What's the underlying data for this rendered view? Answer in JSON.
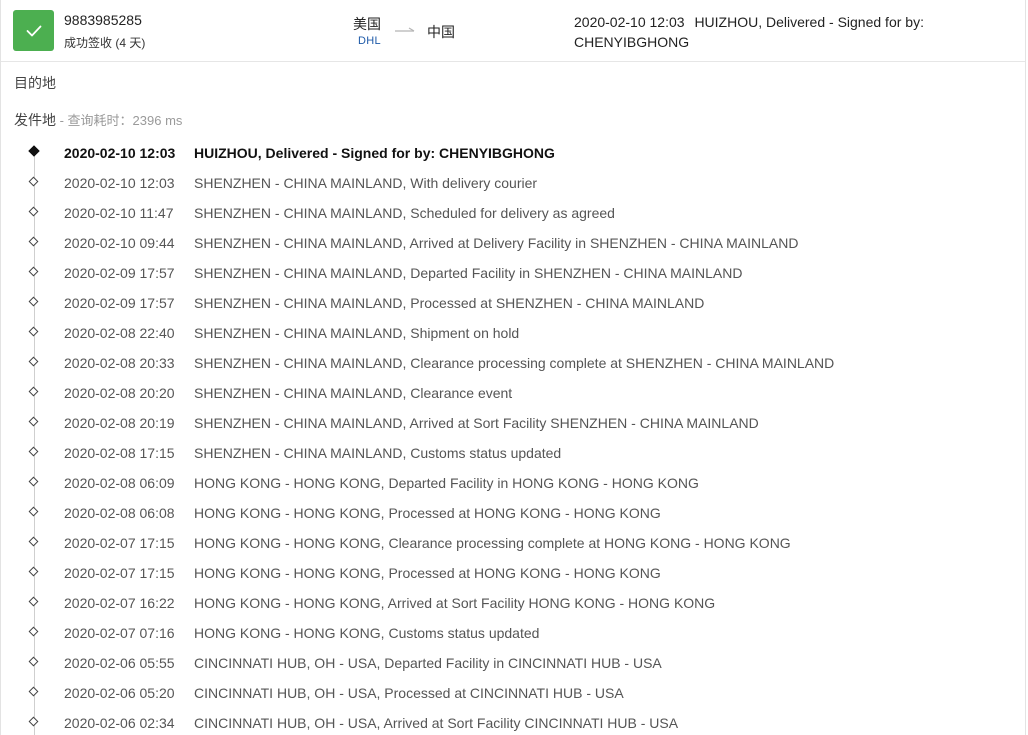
{
  "shipment": {
    "tracking_number": "9883985285",
    "status_text": "成功签收 (4 天)",
    "origin_country": "美国",
    "carrier": "DHL",
    "destination_country": "中国",
    "latest_time": "2020-02-10 12:03",
    "latest_desc": "HUIZHOU, Delivered - Signed for by: CHENYIBGHONG",
    "status_color": "#4caf50"
  },
  "sections": {
    "destination_label": "目的地",
    "origin_label": "发件地",
    "query_time": " - 查询耗时：2396 ms"
  },
  "events": [
    {
      "time": "2020-02-10 12:03",
      "desc": "HUIZHOU, Delivered - Signed for by: CHENYIBGHONG"
    },
    {
      "time": "2020-02-10 12:03",
      "desc": "SHENZHEN - CHINA MAINLAND, With delivery courier"
    },
    {
      "time": "2020-02-10 11:47",
      "desc": "SHENZHEN - CHINA MAINLAND, Scheduled for delivery as agreed"
    },
    {
      "time": "2020-02-10 09:44",
      "desc": "SHENZHEN - CHINA MAINLAND, Arrived at Delivery Facility in SHENZHEN - CHINA MAINLAND"
    },
    {
      "time": "2020-02-09 17:57",
      "desc": "SHENZHEN - CHINA MAINLAND, Departed Facility in SHENZHEN - CHINA MAINLAND"
    },
    {
      "time": "2020-02-09 17:57",
      "desc": "SHENZHEN - CHINA MAINLAND, Processed at SHENZHEN - CHINA MAINLAND"
    },
    {
      "time": "2020-02-08 22:40",
      "desc": "SHENZHEN - CHINA MAINLAND, Shipment on hold"
    },
    {
      "time": "2020-02-08 20:33",
      "desc": "SHENZHEN - CHINA MAINLAND, Clearance processing complete at SHENZHEN - CHINA MAINLAND"
    },
    {
      "time": "2020-02-08 20:20",
      "desc": "SHENZHEN - CHINA MAINLAND, Clearance event"
    },
    {
      "time": "2020-02-08 20:19",
      "desc": "SHENZHEN - CHINA MAINLAND, Arrived at Sort Facility SHENZHEN - CHINA MAINLAND"
    },
    {
      "time": "2020-02-08 17:15",
      "desc": "SHENZHEN - CHINA MAINLAND, Customs status updated"
    },
    {
      "time": "2020-02-08 06:09",
      "desc": "HONG KONG - HONG KONG, Departed Facility in HONG KONG - HONG KONG"
    },
    {
      "time": "2020-02-08 06:08",
      "desc": "HONG KONG - HONG KONG, Processed at HONG KONG - HONG KONG"
    },
    {
      "time": "2020-02-07 17:15",
      "desc": "HONG KONG - HONG KONG, Clearance processing complete at HONG KONG - HONG KONG"
    },
    {
      "time": "2020-02-07 17:15",
      "desc": "HONG KONG - HONG KONG, Processed at HONG KONG - HONG KONG"
    },
    {
      "time": "2020-02-07 16:22",
      "desc": "HONG KONG - HONG KONG, Arrived at Sort Facility HONG KONG - HONG KONG"
    },
    {
      "time": "2020-02-07 07:16",
      "desc": "HONG KONG - HONG KONG, Customs status updated"
    },
    {
      "time": "2020-02-06 05:55",
      "desc": "CINCINNATI HUB, OH - USA, Departed Facility in CINCINNATI HUB - USA"
    },
    {
      "time": "2020-02-06 05:20",
      "desc": "CINCINNATI HUB, OH - USA, Processed at CINCINNATI HUB - USA"
    },
    {
      "time": "2020-02-06 02:34",
      "desc": "CINCINNATI HUB, OH - USA, Arrived at Sort Facility CINCINNATI HUB - USA"
    }
  ]
}
